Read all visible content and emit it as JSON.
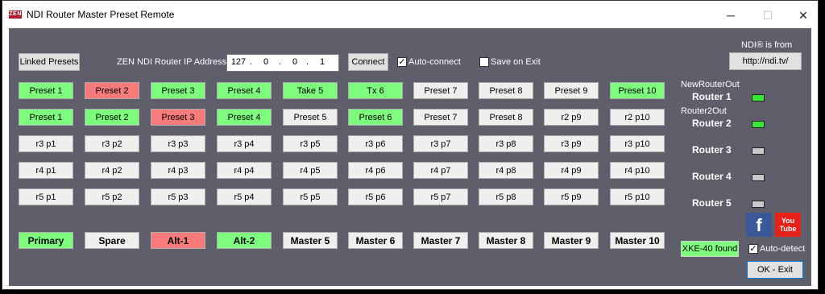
{
  "window": {
    "title": "NDI Router Master Preset Remote",
    "icon_text": "ZEN",
    "minimize": "─",
    "maximize": "☐",
    "close": "✕"
  },
  "top": {
    "linked_presets": "Linked Presets",
    "ip_label": "ZEN NDI Router IP Address",
    "ip_octets": [
      "127",
      "0",
      "0",
      "1"
    ],
    "ip_sep": ".",
    "connect": "Connect",
    "auto_connect_label": "Auto-connect",
    "auto_connect_checked": true,
    "save_on_exit_label": "Save on Exit",
    "save_on_exit_checked": false,
    "ndi_from": "NDI® is from",
    "ndi_link": "http://ndi.tv/"
  },
  "rows": [
    [
      {
        "label": "Preset 1",
        "state": "green"
      },
      {
        "label": "Preset 2",
        "state": "red"
      },
      {
        "label": "Preset 3",
        "state": "green"
      },
      {
        "label": "Preset 4",
        "state": "green"
      },
      {
        "label": "Take 5",
        "state": "green"
      },
      {
        "label": "Tx 6",
        "state": "green"
      },
      {
        "label": "Preset 7",
        "state": "white"
      },
      {
        "label": "Preset 8",
        "state": "white"
      },
      {
        "label": "Preset 9",
        "state": "white"
      },
      {
        "label": "Preset 10",
        "state": "green"
      }
    ],
    [
      {
        "label": "Preset 1",
        "state": "green"
      },
      {
        "label": "Preset 2",
        "state": "green"
      },
      {
        "label": "Preset 3",
        "state": "red"
      },
      {
        "label": "Preset 4",
        "state": "green"
      },
      {
        "label": "Preset 5",
        "state": "white"
      },
      {
        "label": "Preset 6",
        "state": "green"
      },
      {
        "label": "Preset 7",
        "state": "white"
      },
      {
        "label": "Preset 8",
        "state": "white"
      },
      {
        "label": "r2  p9",
        "state": "white"
      },
      {
        "label": "r2  p10",
        "state": "white"
      }
    ],
    [
      {
        "label": "r3  p1",
        "state": "white"
      },
      {
        "label": "r3  p2",
        "state": "white"
      },
      {
        "label": "r3  p3",
        "state": "white"
      },
      {
        "label": "r3  p4",
        "state": "white"
      },
      {
        "label": "r3  p5",
        "state": "white"
      },
      {
        "label": "r3  p6",
        "state": "white"
      },
      {
        "label": "r3  p7",
        "state": "white"
      },
      {
        "label": "r3  p8",
        "state": "white"
      },
      {
        "label": "r3  p9",
        "state": "white"
      },
      {
        "label": "r3  p10",
        "state": "white"
      }
    ],
    [
      {
        "label": "r4  p1",
        "state": "white"
      },
      {
        "label": "r4  p2",
        "state": "white"
      },
      {
        "label": "r4  p3",
        "state": "white"
      },
      {
        "label": "r4  p4",
        "state": "white"
      },
      {
        "label": "r4  p5",
        "state": "white"
      },
      {
        "label": "r4  p6",
        "state": "white"
      },
      {
        "label": "r4  p7",
        "state": "white"
      },
      {
        "label": "r4  p8",
        "state": "white"
      },
      {
        "label": "r4  p9",
        "state": "white"
      },
      {
        "label": "r4  p10",
        "state": "white"
      }
    ],
    [
      {
        "label": "r5  p1",
        "state": "white"
      },
      {
        "label": "r5  p2",
        "state": "white"
      },
      {
        "label": "r5  p3",
        "state": "white"
      },
      {
        "label": "r5  p4",
        "state": "white"
      },
      {
        "label": "r5  p5",
        "state": "white"
      },
      {
        "label": "r5  p6",
        "state": "white"
      },
      {
        "label": "r5  p7",
        "state": "white"
      },
      {
        "label": "r5  p8",
        "state": "white"
      },
      {
        "label": "r5  p9",
        "state": "white"
      },
      {
        "label": "r5  p10",
        "state": "white"
      }
    ]
  ],
  "masters": [
    {
      "label": "Primary",
      "state": "green"
    },
    {
      "label": "Spare",
      "state": "white"
    },
    {
      "label": "Alt-1",
      "state": "red"
    },
    {
      "label": "Alt-2",
      "state": "green"
    },
    {
      "label": "Master 5",
      "state": "white"
    },
    {
      "label": "Master 6",
      "state": "white"
    },
    {
      "label": "Master 7",
      "state": "white"
    },
    {
      "label": "Master 8",
      "state": "white"
    },
    {
      "label": "Master 9",
      "state": "white"
    },
    {
      "label": "Master 10",
      "state": "white"
    }
  ],
  "routers": [
    {
      "name": "Router 1",
      "source": "NewRouterOut",
      "status": "on"
    },
    {
      "name": "Router 2",
      "source": "Router2Out",
      "status": "on"
    },
    {
      "name": "Router 3",
      "source": "",
      "status": "off"
    },
    {
      "name": "Router 4",
      "source": "",
      "status": "off"
    },
    {
      "name": "Router 5",
      "source": "",
      "status": "off"
    }
  ],
  "social": {
    "facebook": "f",
    "youtube_top": "You",
    "youtube_bottom": "Tube"
  },
  "bottom": {
    "xke_status": "XKE-40 found",
    "auto_detect_label": "Auto-detect",
    "auto_detect_checked": true,
    "ok_exit": "OK - Exit"
  },
  "colors": {
    "green": "#7dfc7d",
    "red": "#f77b7b",
    "white": "#efefef",
    "panel": "#5f5f6c",
    "led_on": "#37e637",
    "led_off": "#c9c9c9"
  }
}
